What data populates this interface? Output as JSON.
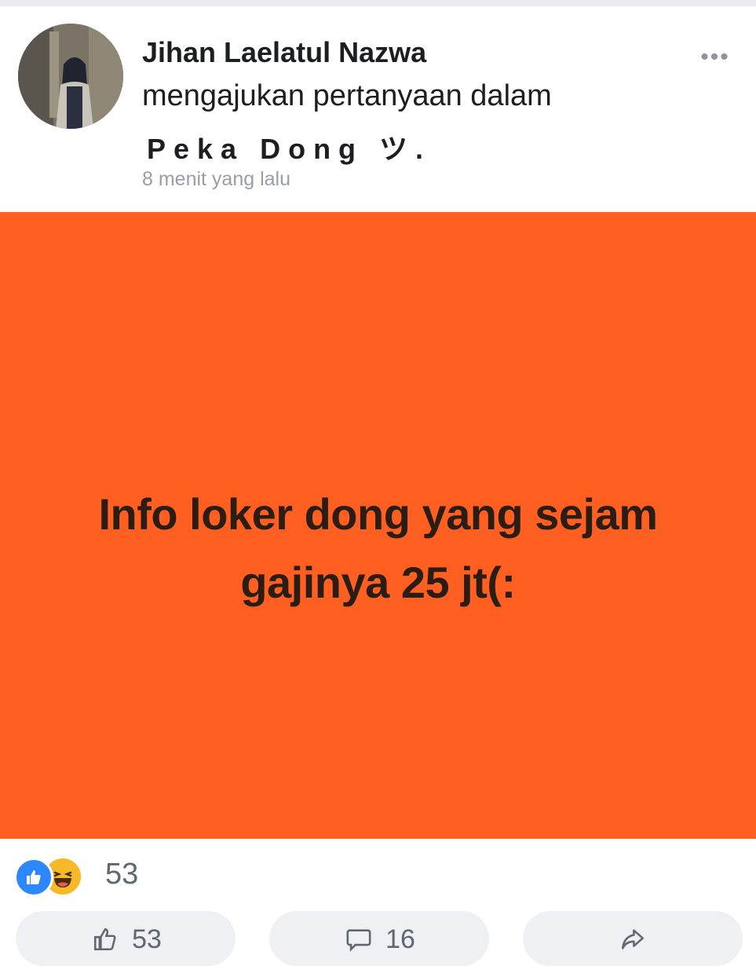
{
  "post": {
    "author_name": "Jihan Laelatul Nazwa",
    "action_text": "mengajukan pertanyaan dalam",
    "group_name": "Peka Dong ツ.",
    "timestamp": "8 menit yang lalu",
    "more_label": "•••",
    "background_color": "#ff6021",
    "text_line_1": "Info loker dong yang sejam",
    "text_line_2": "gajinya 25 jt(:"
  },
  "reactions": {
    "count": "53",
    "types": [
      "like-icon",
      "haha-icon"
    ]
  },
  "actions": {
    "like_count": "53",
    "comment_count": "16"
  },
  "colors": {
    "accent_blue": "#2d88ff",
    "haha_yellow": "#f7b928",
    "meta_gray": "#9a9ea4"
  }
}
